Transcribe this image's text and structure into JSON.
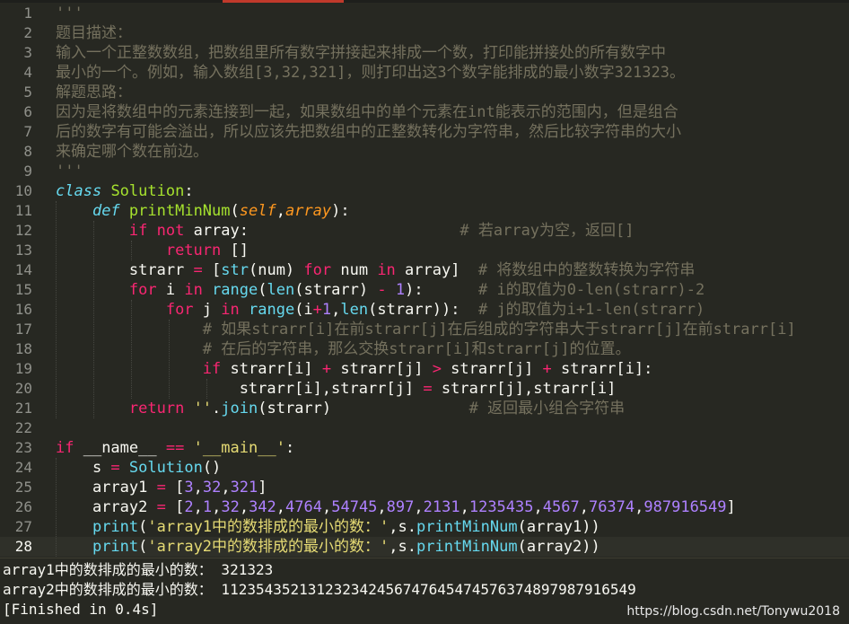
{
  "editor": {
    "current_line": 28,
    "lines": [
      {
        "n": "1",
        "tokens": [
          [
            "'''",
            "comment"
          ]
        ]
      },
      {
        "n": "2",
        "tokens": [
          [
            "题目描述：",
            "comment"
          ]
        ]
      },
      {
        "n": "3",
        "tokens": [
          [
            "输入一个正整数数组，把数组里所有数字拼接起来排成一个数，打印能拼接处的所有数字中",
            "comment"
          ]
        ]
      },
      {
        "n": "4",
        "tokens": [
          [
            "最小的一个。例如，输入数组[3,32,321]，则打印出这3个数字能排成的最小数字321323。",
            "comment"
          ]
        ]
      },
      {
        "n": "5",
        "tokens": [
          [
            "解题思路：",
            "comment"
          ]
        ]
      },
      {
        "n": "6",
        "tokens": [
          [
            "因为是将数组中的元素连接到一起，如果数组中的单个元素在int能表示的范围内，但是组合",
            "comment"
          ]
        ]
      },
      {
        "n": "7",
        "tokens": [
          [
            "后的数字有可能会溢出，所以应该先把数组中的正整数转化为字符串，然后比较字符串的大小",
            "comment"
          ]
        ]
      },
      {
        "n": "8",
        "tokens": [
          [
            "来确定哪个数在前边。",
            "comment"
          ]
        ]
      },
      {
        "n": "9",
        "tokens": [
          [
            "'''",
            "comment"
          ]
        ]
      },
      {
        "n": "10",
        "tokens": [
          [
            "class",
            "class"
          ],
          [
            " ",
            ""
          ],
          [
            "Solution",
            "name"
          ],
          [
            ":",
            ""
          ]
        ]
      },
      {
        "n": "11",
        "tokens": [
          [
            "    ",
            ""
          ],
          [
            "def",
            "class"
          ],
          [
            " ",
            ""
          ],
          [
            "printMinNum",
            "name"
          ],
          [
            "(",
            ""
          ],
          [
            "self",
            "param"
          ],
          [
            ",",
            ""
          ],
          [
            "array",
            "param"
          ],
          [
            "):",
            ""
          ]
        ]
      },
      {
        "n": "12",
        "tokens": [
          [
            "        ",
            ""
          ],
          [
            "if",
            "kw"
          ],
          [
            " ",
            ""
          ],
          [
            "not",
            "kw"
          ],
          [
            " array:                       ",
            ""
          ],
          [
            "# 若array为空，返回[]",
            "comment"
          ]
        ]
      },
      {
        "n": "13",
        "tokens": [
          [
            "            ",
            ""
          ],
          [
            "return",
            "kw"
          ],
          [
            " []",
            ""
          ]
        ]
      },
      {
        "n": "14",
        "tokens": [
          [
            "        strarr ",
            ""
          ],
          [
            "=",
            "op"
          ],
          [
            " [",
            ""
          ],
          [
            "str",
            "builtin"
          ],
          [
            "(num) ",
            ""
          ],
          [
            "for",
            "kw"
          ],
          [
            " num ",
            ""
          ],
          [
            "in",
            "kw"
          ],
          [
            " array]  ",
            ""
          ],
          [
            "# 将数组中的整数转换为字符串",
            "comment"
          ]
        ]
      },
      {
        "n": "15",
        "tokens": [
          [
            "        ",
            ""
          ],
          [
            "for",
            "kw"
          ],
          [
            " i ",
            ""
          ],
          [
            "in",
            "kw"
          ],
          [
            " ",
            ""
          ],
          [
            "range",
            "builtin"
          ],
          [
            "(",
            ""
          ],
          [
            "len",
            "builtin"
          ],
          [
            "(strarr) ",
            ""
          ],
          [
            "-",
            "op"
          ],
          [
            " ",
            ""
          ],
          [
            "1",
            "num"
          ],
          [
            "):      ",
            ""
          ],
          [
            "# i的取值为0-len(strarr)-2",
            "comment"
          ]
        ]
      },
      {
        "n": "16",
        "tokens": [
          [
            "            ",
            ""
          ],
          [
            "for",
            "kw"
          ],
          [
            " j ",
            ""
          ],
          [
            "in",
            "kw"
          ],
          [
            " ",
            ""
          ],
          [
            "range",
            "builtin"
          ],
          [
            "(i",
            ""
          ],
          [
            "+",
            "op"
          ],
          [
            "1",
            "num"
          ],
          [
            ",",
            ""
          ],
          [
            "len",
            "builtin"
          ],
          [
            "(strarr)):  ",
            ""
          ],
          [
            "# j的取值为i+1-len(strarr)",
            "comment"
          ]
        ]
      },
      {
        "n": "17",
        "tokens": [
          [
            "                ",
            ""
          ],
          [
            "# 如果strarr[i]在前strarr[j]在后组成的字符串大于strarr[j]在前strarr[i]",
            "comment"
          ]
        ]
      },
      {
        "n": "18",
        "tokens": [
          [
            "                ",
            ""
          ],
          [
            "# 在后的字符串，那么交换strarr[i]和strarr[j]的位置。",
            "comment"
          ]
        ]
      },
      {
        "n": "19",
        "tokens": [
          [
            "                ",
            ""
          ],
          [
            "if",
            "kw"
          ],
          [
            " strarr[i] ",
            ""
          ],
          [
            "+",
            "op"
          ],
          [
            " strarr[j] ",
            ""
          ],
          [
            ">",
            "op"
          ],
          [
            " strarr[j] ",
            ""
          ],
          [
            "+",
            "op"
          ],
          [
            " strarr[i]:",
            ""
          ]
        ]
      },
      {
        "n": "20",
        "tokens": [
          [
            "                    strarr[i],strarr[j] ",
            ""
          ],
          [
            "=",
            "op"
          ],
          [
            " strarr[j],strarr[i]",
            ""
          ]
        ]
      },
      {
        "n": "21",
        "tokens": [
          [
            "        ",
            ""
          ],
          [
            "return",
            "kw"
          ],
          [
            " ",
            ""
          ],
          [
            "''",
            "str"
          ],
          [
            ".",
            ""
          ],
          [
            "join",
            "builtin"
          ],
          [
            "(strarr)               ",
            ""
          ],
          [
            "# 返回最小组合字符串",
            "comment"
          ]
        ]
      },
      {
        "n": "22",
        "tokens": []
      },
      {
        "n": "23",
        "tokens": [
          [
            "if",
            "kw"
          ],
          [
            " __name__ ",
            ""
          ],
          [
            "==",
            "op"
          ],
          [
            " ",
            ""
          ],
          [
            "'__main__'",
            "str"
          ],
          [
            ":",
            ""
          ]
        ]
      },
      {
        "n": "24",
        "tokens": [
          [
            "    s ",
            ""
          ],
          [
            "=",
            "op"
          ],
          [
            " ",
            ""
          ],
          [
            "Solution",
            "builtin"
          ],
          [
            "()",
            ""
          ]
        ]
      },
      {
        "n": "25",
        "tokens": [
          [
            "    array1 ",
            ""
          ],
          [
            "=",
            "op"
          ],
          [
            " [",
            ""
          ],
          [
            "3",
            "num"
          ],
          [
            ",",
            ""
          ],
          [
            "32",
            "num"
          ],
          [
            ",",
            ""
          ],
          [
            "321",
            "num"
          ],
          [
            "]",
            ""
          ]
        ]
      },
      {
        "n": "26",
        "tokens": [
          [
            "    array2 ",
            ""
          ],
          [
            "=",
            "op"
          ],
          [
            " [",
            ""
          ],
          [
            "2",
            "num"
          ],
          [
            ",",
            ""
          ],
          [
            "1",
            "num"
          ],
          [
            ",",
            ""
          ],
          [
            "32",
            "num"
          ],
          [
            ",",
            ""
          ],
          [
            "342",
            "num"
          ],
          [
            ",",
            ""
          ],
          [
            "4764",
            "num"
          ],
          [
            ",",
            ""
          ],
          [
            "54745",
            "num"
          ],
          [
            ",",
            ""
          ],
          [
            "897",
            "num"
          ],
          [
            ",",
            ""
          ],
          [
            "2131",
            "num"
          ],
          [
            ",",
            ""
          ],
          [
            "1235435",
            "num"
          ],
          [
            ",",
            ""
          ],
          [
            "4567",
            "num"
          ],
          [
            ",",
            ""
          ],
          [
            "76374",
            "num"
          ],
          [
            ",",
            ""
          ],
          [
            "987916549",
            "num"
          ],
          [
            "]",
            ""
          ]
        ]
      },
      {
        "n": "27",
        "tokens": [
          [
            "    ",
            ""
          ],
          [
            "print",
            "builtin"
          ],
          [
            "(",
            ""
          ],
          [
            "'array1中的数排成的最小的数：'",
            "str"
          ],
          [
            ",s.",
            ""
          ],
          [
            "printMinNum",
            "builtin"
          ],
          [
            "(array1))",
            ""
          ]
        ]
      },
      {
        "n": "28",
        "tokens": [
          [
            "    ",
            ""
          ],
          [
            "print",
            "builtin"
          ],
          [
            "(",
            ""
          ],
          [
            "'array2中的数排成的最小的数：'",
            "str"
          ],
          [
            ",s.",
            ""
          ],
          [
            "printMinNum",
            "builtin"
          ],
          [
            "(array2))",
            ""
          ]
        ]
      }
    ]
  },
  "output": {
    "line1": "array1中的数排成的最小的数： 321323",
    "line2": "array2中的数排成的最小的数： 11235435213123234245674764547457637489798791654‌9",
    "line3": "[Finished in 0.4s]"
  },
  "watermark": "https://blog.csdn.net/Tonywu2018",
  "colors": {
    "background": "#272822",
    "comment": "#75715e",
    "keyword": "#f92672",
    "function_name": "#a6e22e",
    "param": "#fd971f",
    "builtin": "#66d9ef",
    "string": "#e6db74",
    "number": "#ae81ff"
  }
}
